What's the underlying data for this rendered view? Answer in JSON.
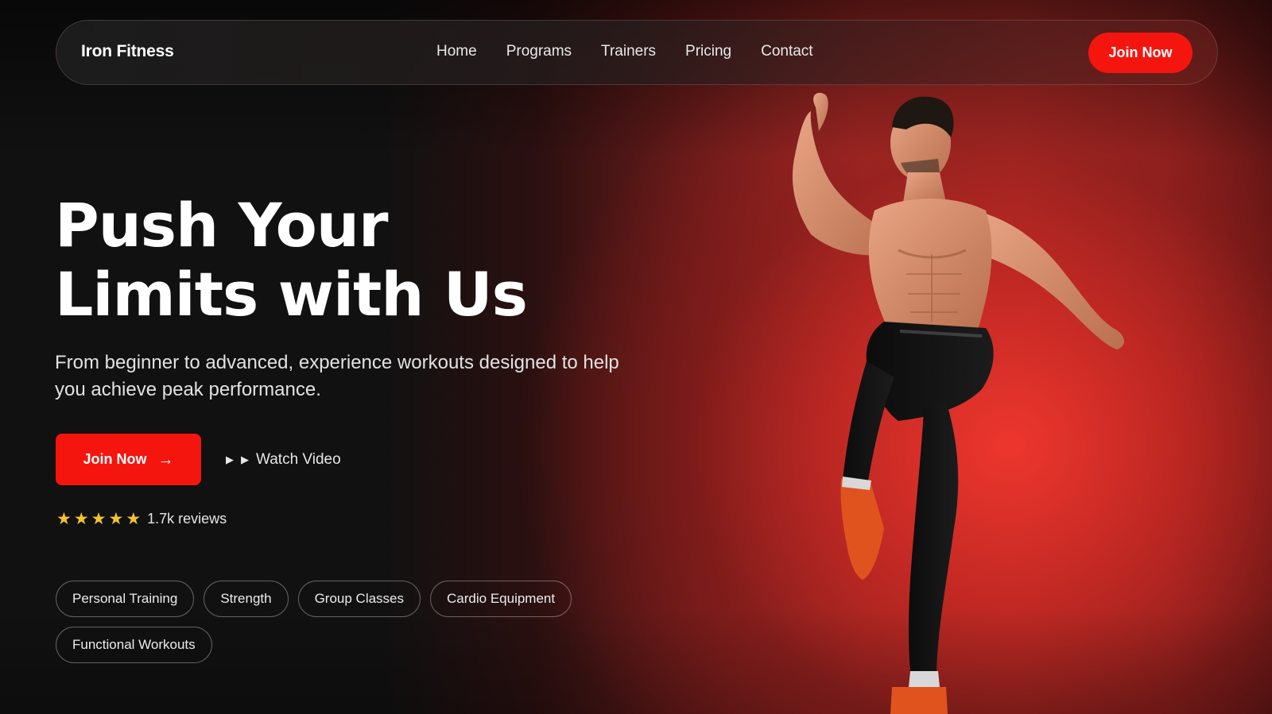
{
  "nav": {
    "brand": "Iron Fitness",
    "links": [
      "Home",
      "Programs",
      "Trainers",
      "Pricing",
      "Contact"
    ],
    "cta_label": "Join Now"
  },
  "hero": {
    "title_line1": "Push Your",
    "title_line2": "Limits with Us",
    "subtitle": "From beginner to advanced, experience workouts designed to help you achieve peak performance.",
    "primary_cta": "Join Now",
    "primary_cta_icon": "arrow-right-icon",
    "secondary_cta": "Watch Video",
    "secondary_cta_icon": "play-icon",
    "rating_stars": 5,
    "reviews": "1.7k reviews",
    "tags": [
      "Personal Training",
      "Strength",
      "Group Classes",
      "Cardio Equipment",
      "Functional Workouts"
    ]
  },
  "colors": {
    "accent": "#f5150f",
    "star": "#f4c430",
    "background_dark": "#111111",
    "background_red": "#e8392e"
  }
}
